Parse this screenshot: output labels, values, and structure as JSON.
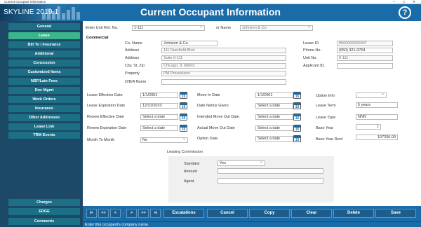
{
  "window": {
    "title": "Current Occupant Information",
    "minimize": "–",
    "maximize": "□",
    "close": "✕"
  },
  "app": {
    "logo": "SKYLINE 2019.1",
    "page_title": "Current Occupant Information",
    "help": "?"
  },
  "sidebar": {
    "items": [
      {
        "label": "General",
        "active": false
      },
      {
        "label": "Lease",
        "active": true
      },
      {
        "label": "Bill To / Insurance",
        "active": false
      },
      {
        "label": "Additional",
        "active": false
      },
      {
        "label": "Concession",
        "active": false
      },
      {
        "label": "Customized Items",
        "active": false
      },
      {
        "label": "NSF/Late Fees",
        "active": false
      },
      {
        "label": "Doc Mgmt",
        "active": false
      },
      {
        "label": "Work Orders",
        "active": false
      },
      {
        "label": "Insurance",
        "active": false
      },
      {
        "label": "Other Addresses",
        "active": false
      },
      {
        "label": "Lease Link",
        "active": false
      },
      {
        "label": "TRM Events",
        "active": false
      }
    ],
    "bottom_items": [
      {
        "label": "Charges"
      },
      {
        "label": "EDGE"
      },
      {
        "label": "Comments"
      }
    ]
  },
  "header_fields": {
    "unit_ref_label": "Enter Unit Ref. No.",
    "unit_ref_value": "1-111",
    "or_name_label": "or Name",
    "name_value": "Johnson & Co."
  },
  "commercial": {
    "section_label": "Commercial",
    "co_name_label": "Co. Name",
    "co_name_value": "Johnson & Co.",
    "address_label": "Address",
    "address_value": "111 Deerfield Blvd.",
    "address2_label": "Address",
    "address2_value": "Suite 0-111",
    "city_label": "City, St, Zip",
    "city_value": "Chicago, IL 60603",
    "property_label": "Property",
    "property_value": "PM Procedures",
    "dba_label": "D/B/A Name",
    "dba_value": "",
    "lease_id_label": "Lease ID.",
    "lease_id_value": "8500000000007",
    "phone_label": "Phone No.",
    "phone_value": "(650) 321-0764",
    "unit_no_label": "Unit No.",
    "unit_no_value": "0-111",
    "applicant_id_label": "Applicant ID.",
    "applicant_id_value": ""
  },
  "lease": {
    "effective_label": "Lease Effective Date",
    "effective_value": "1/1/2001",
    "expiration_label": "Lease Expiration Date",
    "expiration_value": "12/31/2010",
    "renew_effective_label": "Renew Effective Date",
    "renew_effective_value": "Select a date",
    "renew_expiration_label": "Renew Expiration Date",
    "renew_expiration_value": "Select a date",
    "month_to_month_label": "Month To Month",
    "month_to_month_value": "No",
    "move_in_label": "Move In Date",
    "move_in_value": "1/1/2001",
    "notice_label": "Date Notice Given",
    "notice_value": "Select a date",
    "intended_move_out_label": "Intended Move Out Date",
    "intended_move_out_value": "Select a date",
    "actual_move_out_label": "Actual Move Out Date",
    "actual_move_out_value": "Select a date",
    "option_date_label": "Option Date",
    "option_date_value": "Select a date",
    "option_info_label": "Option Info",
    "option_info_value": "",
    "term_label": "Lease Term",
    "term_value": "5 years",
    "type_label": "Lease Type",
    "type_value": "NNN",
    "base_year_label": "Base Year",
    "base_year_value": "1",
    "base_rent_label": "Base Year Rent",
    "base_rent_value": "107250.00",
    "calendar_day": "15"
  },
  "commission": {
    "title": "Leasing Commission",
    "standard_label": "Standard",
    "standard_value": "Yes",
    "amount_label": "Amount",
    "amount_value": "",
    "agent_label": "Agent",
    "agent_value": ""
  },
  "nav_buttons": [
    "|<",
    "<<",
    "<",
    ">",
    ">>",
    ">|"
  ],
  "actions": [
    "Escalations",
    "Cancel",
    "Copy",
    "Clear",
    "Delete",
    "Save"
  ],
  "status": "Enter this occupant's company name."
}
